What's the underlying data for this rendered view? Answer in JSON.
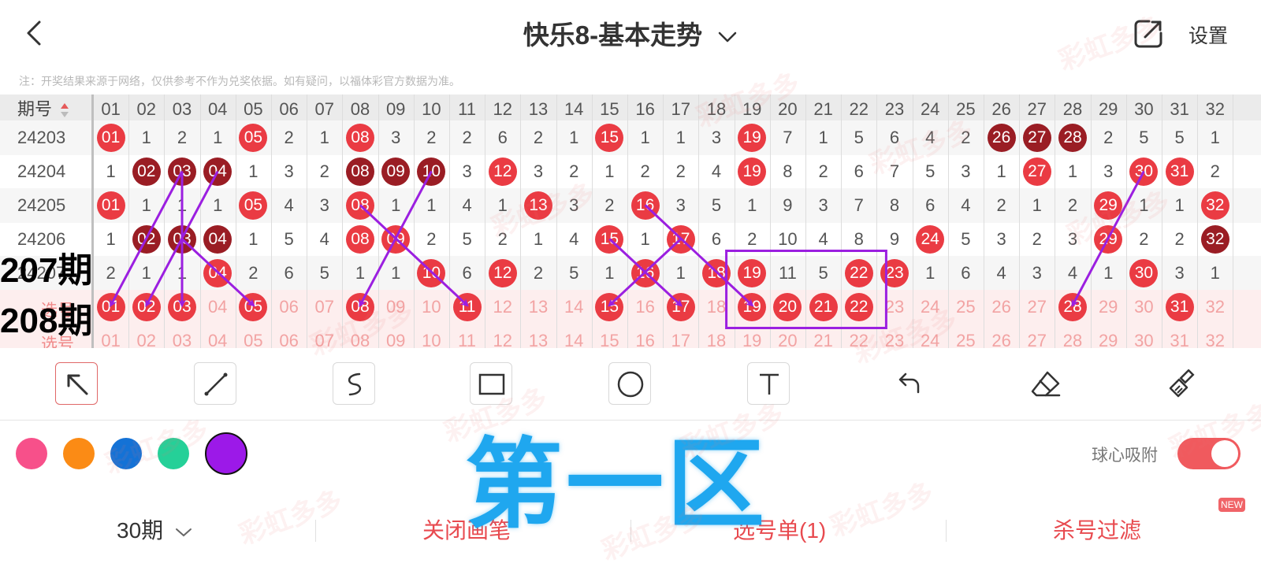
{
  "header": {
    "title": "快乐8-基本走势",
    "settings_label": "设置"
  },
  "notice": "注：开奖结果来源于网络，仅供参考不作为兑奖依据。如有疑问，以福体彩官方数据为准。",
  "grid": {
    "period_header": "期号",
    "columns": [
      "01",
      "02",
      "03",
      "04",
      "05",
      "06",
      "07",
      "08",
      "09",
      "10",
      "11",
      "12",
      "13",
      "14",
      "15",
      "16",
      "17",
      "18",
      "19",
      "20",
      "21",
      "22",
      "23",
      "24",
      "25",
      "26",
      "27",
      "28",
      "29",
      "30",
      "31",
      "32"
    ],
    "rows": [
      {
        "period": "24203",
        "cells": [
          {
            "v": "01",
            "b": "red"
          },
          {
            "v": "1"
          },
          {
            "v": "2"
          },
          {
            "v": "1"
          },
          {
            "v": "05",
            "b": "red"
          },
          {
            "v": "2"
          },
          {
            "v": "1"
          },
          {
            "v": "08",
            "b": "red"
          },
          {
            "v": "3"
          },
          {
            "v": "2"
          },
          {
            "v": "2"
          },
          {
            "v": "6"
          },
          {
            "v": "2"
          },
          {
            "v": "1"
          },
          {
            "v": "15",
            "b": "red"
          },
          {
            "v": "1"
          },
          {
            "v": "1"
          },
          {
            "v": "3"
          },
          {
            "v": "19",
            "b": "red"
          },
          {
            "v": "7"
          },
          {
            "v": "1"
          },
          {
            "v": "5"
          },
          {
            "v": "6"
          },
          {
            "v": "4"
          },
          {
            "v": "2"
          },
          {
            "v": "26",
            "b": "dark"
          },
          {
            "v": "27",
            "b": "dark"
          },
          {
            "v": "28",
            "b": "dark"
          },
          {
            "v": "2"
          },
          {
            "v": "5"
          },
          {
            "v": "5"
          },
          {
            "v": "1"
          }
        ]
      },
      {
        "period": "24204",
        "cells": [
          {
            "v": "1"
          },
          {
            "v": "02",
            "b": "dark"
          },
          {
            "v": "03",
            "b": "dark"
          },
          {
            "v": "04",
            "b": "dark"
          },
          {
            "v": "1"
          },
          {
            "v": "3"
          },
          {
            "v": "2"
          },
          {
            "v": "08",
            "b": "dark"
          },
          {
            "v": "09",
            "b": "dark"
          },
          {
            "v": "10",
            "b": "dark"
          },
          {
            "v": "3"
          },
          {
            "v": "12",
            "b": "red"
          },
          {
            "v": "3"
          },
          {
            "v": "2"
          },
          {
            "v": "1"
          },
          {
            "v": "2"
          },
          {
            "v": "2"
          },
          {
            "v": "4"
          },
          {
            "v": "19",
            "b": "red"
          },
          {
            "v": "8"
          },
          {
            "v": "2"
          },
          {
            "v": "6"
          },
          {
            "v": "7"
          },
          {
            "v": "5"
          },
          {
            "v": "3"
          },
          {
            "v": "1"
          },
          {
            "v": "27",
            "b": "red"
          },
          {
            "v": "1"
          },
          {
            "v": "3"
          },
          {
            "v": "30",
            "b": "red"
          },
          {
            "v": "31",
            "b": "red"
          },
          {
            "v": "2"
          }
        ]
      },
      {
        "period": "24205",
        "cells": [
          {
            "v": "01",
            "b": "red"
          },
          {
            "v": "1"
          },
          {
            "v": "1"
          },
          {
            "v": "1"
          },
          {
            "v": "05",
            "b": "red"
          },
          {
            "v": "4"
          },
          {
            "v": "3"
          },
          {
            "v": "08",
            "b": "red"
          },
          {
            "v": "1"
          },
          {
            "v": "1"
          },
          {
            "v": "4"
          },
          {
            "v": "1"
          },
          {
            "v": "13",
            "b": "red"
          },
          {
            "v": "3"
          },
          {
            "v": "2"
          },
          {
            "v": "16",
            "b": "red"
          },
          {
            "v": "3"
          },
          {
            "v": "5"
          },
          {
            "v": "1"
          },
          {
            "v": "9"
          },
          {
            "v": "3"
          },
          {
            "v": "7"
          },
          {
            "v": "8"
          },
          {
            "v": "6"
          },
          {
            "v": "4"
          },
          {
            "v": "2"
          },
          {
            "v": "1"
          },
          {
            "v": "2"
          },
          {
            "v": "29",
            "b": "red"
          },
          {
            "v": "1"
          },
          {
            "v": "1"
          },
          {
            "v": "32",
            "b": "red"
          }
        ]
      },
      {
        "period": "24206",
        "cells": [
          {
            "v": "1"
          },
          {
            "v": "02",
            "b": "dark"
          },
          {
            "v": "03",
            "b": "dark"
          },
          {
            "v": "04",
            "b": "dark"
          },
          {
            "v": "1"
          },
          {
            "v": "5"
          },
          {
            "v": "4"
          },
          {
            "v": "08",
            "b": "red"
          },
          {
            "v": "09",
            "b": "red"
          },
          {
            "v": "2"
          },
          {
            "v": "5"
          },
          {
            "v": "2"
          },
          {
            "v": "1"
          },
          {
            "v": "4"
          },
          {
            "v": "15",
            "b": "red"
          },
          {
            "v": "1"
          },
          {
            "v": "17",
            "b": "red"
          },
          {
            "v": "6"
          },
          {
            "v": "2"
          },
          {
            "v": "10"
          },
          {
            "v": "4"
          },
          {
            "v": "8"
          },
          {
            "v": "9"
          },
          {
            "v": "24",
            "b": "red"
          },
          {
            "v": "5"
          },
          {
            "v": "3"
          },
          {
            "v": "2"
          },
          {
            "v": "3"
          },
          {
            "v": "29",
            "b": "red"
          },
          {
            "v": "2"
          },
          {
            "v": "2"
          },
          {
            "v": "32",
            "b": "dark"
          }
        ]
      },
      {
        "period": "24207",
        "cells": [
          {
            "v": "2"
          },
          {
            "v": "1"
          },
          {
            "v": "1"
          },
          {
            "v": "04",
            "b": "red"
          },
          {
            "v": "2"
          },
          {
            "v": "6"
          },
          {
            "v": "5"
          },
          {
            "v": "1"
          },
          {
            "v": "1"
          },
          {
            "v": "10",
            "b": "red"
          },
          {
            "v": "6"
          },
          {
            "v": "12",
            "b": "red"
          },
          {
            "v": "2"
          },
          {
            "v": "5"
          },
          {
            "v": "1"
          },
          {
            "v": "16",
            "b": "red"
          },
          {
            "v": "1"
          },
          {
            "v": "18",
            "b": "red"
          },
          {
            "v": "19",
            "b": "red"
          },
          {
            "v": "11"
          },
          {
            "v": "5"
          },
          {
            "v": "22",
            "b": "red"
          },
          {
            "v": "23",
            "b": "red"
          },
          {
            "v": "1"
          },
          {
            "v": "6"
          },
          {
            "v": "4"
          },
          {
            "v": "3"
          },
          {
            "v": "4"
          },
          {
            "v": "1"
          },
          {
            "v": "30",
            "b": "red"
          },
          {
            "v": "3"
          },
          {
            "v": "1"
          }
        ]
      }
    ],
    "pick_rows": [
      {
        "label": "选号",
        "selected": [
          "01",
          "02",
          "03",
          "05",
          "08",
          "11",
          "15",
          "17",
          "19",
          "20",
          "21",
          "22",
          "28",
          "31"
        ]
      },
      {
        "label": "选号",
        "selected": []
      }
    ]
  },
  "annotations": {
    "label_207": "207期",
    "label_208": "208期",
    "zone_text": "第一区",
    "color": "#9b1fe0"
  },
  "tools": [
    {
      "name": "arrow-tool"
    },
    {
      "name": "line-tool"
    },
    {
      "name": "curve-tool"
    },
    {
      "name": "rectangle-tool"
    },
    {
      "name": "circle-tool"
    },
    {
      "name": "text-tool"
    },
    {
      "name": "undo-tool"
    },
    {
      "name": "eraser-tool"
    },
    {
      "name": "clear-tool"
    }
  ],
  "palette": [
    "#f7508a",
    "#fb8b15",
    "#1472d6",
    "#25d098",
    "#9c19e8"
  ],
  "magnet_label": "球心吸附",
  "magnet_on": true,
  "bottom_bar": {
    "periods": "30期",
    "close_draw": "关闭画笔",
    "pick_list": "选号单(1)",
    "kill_filter": "杀号过滤",
    "new_badge": "NEW"
  },
  "watermark": "彩虹多多"
}
